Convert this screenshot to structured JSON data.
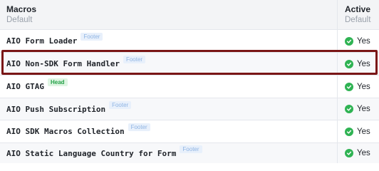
{
  "header": {
    "macros_label": "Macros",
    "macros_sub": "Default",
    "active_label": "Active",
    "active_sub": "Default"
  },
  "rows": [
    {
      "name": "AIO Form Loader",
      "badge": "Footer",
      "badge_type": "footer",
      "active": "Yes"
    },
    {
      "name": "AIO Non-SDK Form Handler",
      "badge": "Footer",
      "badge_type": "footer",
      "active": "Yes",
      "selected": true
    },
    {
      "name": "AIO GTAG",
      "badge": "Head",
      "badge_type": "head",
      "active": "Yes"
    },
    {
      "name": "AIO Push Subscription",
      "badge": "Footer",
      "badge_type": "footer",
      "active": "Yes"
    },
    {
      "name": "AIO SDK Macros Collection",
      "badge": "Footer",
      "badge_type": "footer",
      "active": "Yes"
    },
    {
      "name": "AIO Static Language Country for Form",
      "badge": "Footer",
      "badge_type": "footer",
      "active": "Yes"
    }
  ],
  "colors": {
    "highlight": "#7a1616",
    "check": "#2fb353",
    "footer_badge_text": "#8fb4e3",
    "head_badge_text": "#24a148"
  },
  "icons": {
    "active_status": "check-circle-icon"
  }
}
